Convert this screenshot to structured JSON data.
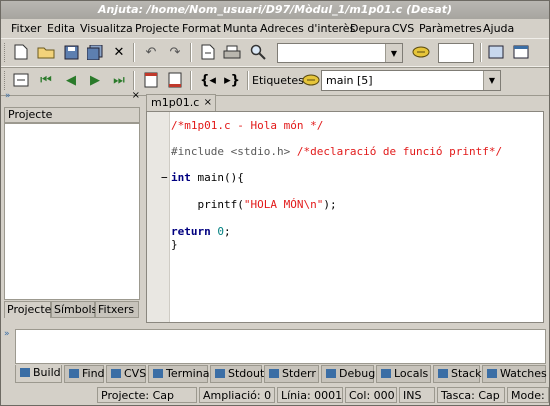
{
  "window": {
    "title": "Anjuta: /home/Nom_usuari/D97/Mòdul_1/m1p01.c (Desat)"
  },
  "menu": [
    "Fitxer",
    "Edita",
    "Visualitza",
    "Projecte",
    "Format",
    "Munta",
    "Adreces d'interès",
    "Depura",
    "CVS",
    "Paràmetres",
    "Ajuda"
  ],
  "toolbar2": {
    "tags_label": "Etiquetes:",
    "tags_value": "main [5]"
  },
  "left_panel": {
    "title": "Projecte",
    "tabs": [
      "Projecte",
      "Símbols",
      "Fitxers"
    ]
  },
  "editor": {
    "tab_label": "m1p01.c",
    "lines": {
      "l1": "/*m1p01.c - Hola món */",
      "l2a": "#include <stdio.h> ",
      "l2b": "/*declaració de funció printf*/",
      "l3a": "int",
      "l3b": " main(){",
      "l4a": "    printf(",
      "l4b": "\"HOLA MÓN\\n\"",
      "l4c": ");",
      "l5a": "return",
      "l5b": " ",
      "l5c": "0",
      "l5d": ";",
      "l6": "}"
    }
  },
  "bottom_tabs": [
    "Build",
    "Find",
    "CVS",
    "Terminal",
    "Stdout",
    "Stderr",
    "Debug",
    "Locals",
    "Stack",
    "Watches"
  ],
  "status": {
    "project": "Projecte: Cap",
    "zoom": "Ampliació: 0",
    "line": "Línia: 0001",
    "col": "Col: 000",
    "mode": "INS",
    "task": "Tasca: Cap",
    "edit_mode": "Mode: U"
  },
  "colors": {
    "background": "#d4d0c8",
    "comment": "#e21a1a",
    "keyword": "#000080",
    "number": "#008080"
  }
}
